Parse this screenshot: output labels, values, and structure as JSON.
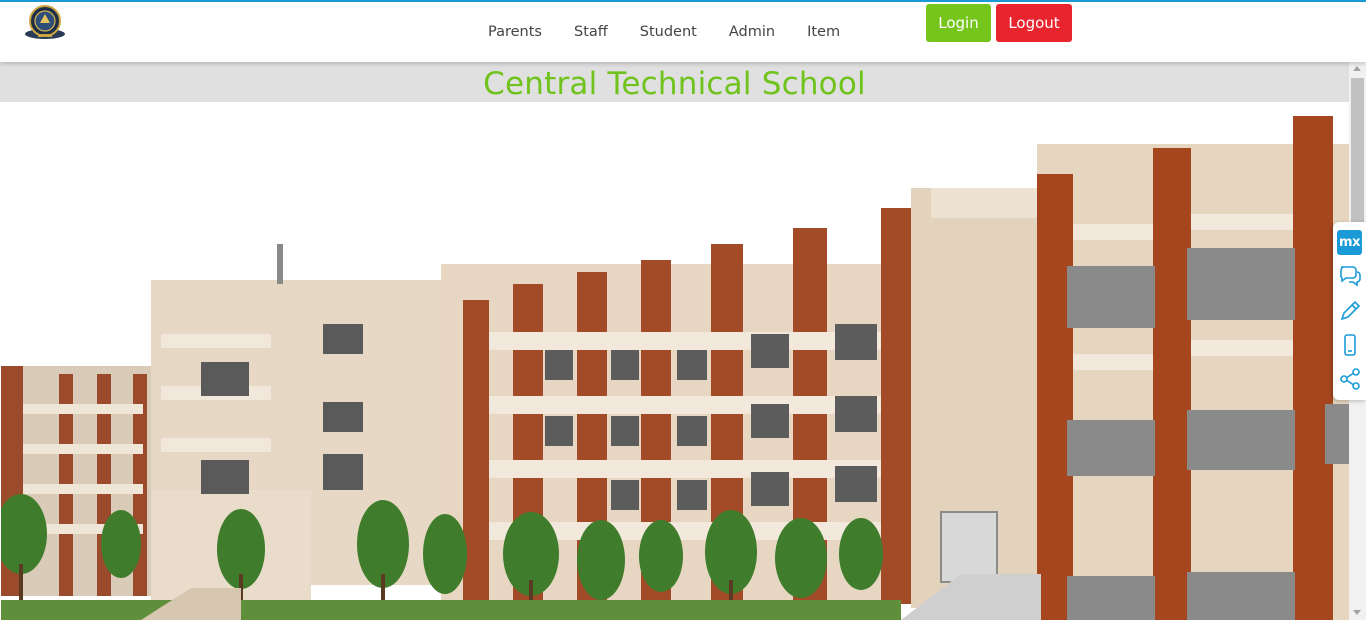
{
  "header": {
    "nav": [
      "Parents",
      "Staff",
      "Student",
      "Admin",
      "Item"
    ],
    "login_label": "Login",
    "logout_label": "Logout"
  },
  "page": {
    "title": "Central Technical School"
  },
  "side_panel": {
    "badge_text": "mx",
    "icons": [
      "mx-logo-icon",
      "chat-bubbles-icon",
      "pencil-icon",
      "mobile-phone-icon",
      "share-icon"
    ]
  },
  "colors": {
    "accent_green": "#76c51c",
    "title_green": "#6fc31c",
    "logout_red": "#e8242f",
    "top_border_blue": "#1a9bd7"
  }
}
